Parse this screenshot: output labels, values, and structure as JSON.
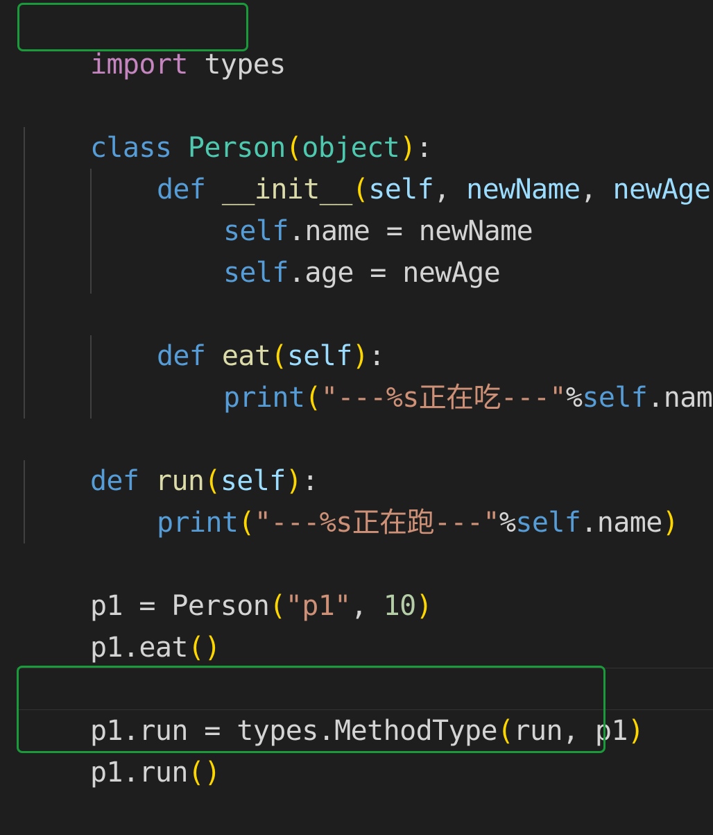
{
  "editor": {
    "theme_colors": {
      "background": "#1e1e1e",
      "highlight_box": "#1a9a3a",
      "import_keyword": "#c586c0",
      "keyword": "#569cd6",
      "class_name": "#4ec9b0",
      "function_name": "#dcdcaa",
      "parameter": "#9cdcfe",
      "string": "#ce9178",
      "number": "#b5cea8",
      "bracket": "#ffd700",
      "plain": "#d4d4d4"
    },
    "lines": {
      "l1": {
        "kw": "import",
        "mod": " types"
      },
      "l3": {
        "kw": "class",
        "sp": " ",
        "name": "Person",
        "op": "(",
        "base": "object",
        "cp": ")",
        "colon": ":"
      },
      "l4": {
        "kw": "def",
        "sp": " ",
        "name": "__init__",
        "op": "(",
        "p1": "self",
        "c1": ", ",
        "p2": "newName",
        "c2": ", ",
        "p3": "newAge",
        "cp": ")",
        "colon": ":"
      },
      "l5": {
        "self": "self",
        "rest": ".name = newName"
      },
      "l6": {
        "self": "self",
        "rest": ".age = newAge"
      },
      "l8": {
        "kw": "def",
        "sp": " ",
        "name": "eat",
        "op": "(",
        "p1": "self",
        "cp": ")",
        "colon": ":"
      },
      "l9": {
        "name": "print",
        "op": "(",
        "str": "\"---%s正在吃---\"",
        "pct": "%",
        "self": "self",
        "rest": ".name",
        "cp": ")"
      },
      "l11": {
        "kw": "def",
        "sp": " ",
        "name": "run",
        "op": "(",
        "p1": "self",
        "cp": ")",
        "colon": ":"
      },
      "l12": {
        "name": "print",
        "op": "(",
        "str": "\"---%s正在跑---\"",
        "pct": "%",
        "self": "self",
        "rest": ".name",
        "cp": ")"
      },
      "l14": {
        "pre": "p1 = Person",
        "op": "(",
        "str": "\"p1\"",
        "c1": ", ",
        "num": "10",
        "cp": ")"
      },
      "l15": {
        "pre": "p1.eat",
        "op": "(",
        "cp": ")"
      },
      "l17": {
        "pre": "p1.run = types.MethodType",
        "op": "(",
        "args": "run, p1",
        "cp": ")"
      },
      "l18": {
        "pre": "p1.run",
        "op": "(",
        "cp": ")"
      }
    }
  }
}
